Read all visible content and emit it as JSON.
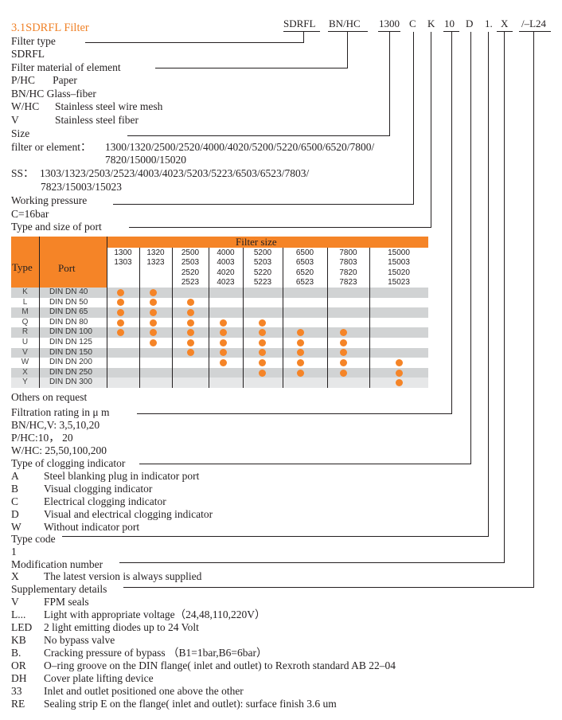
{
  "title": "3.1SDRFL Filter",
  "order_code": [
    {
      "key": "type",
      "text": "SDRFL"
    },
    {
      "key": "material",
      "text": "BN/HC"
    },
    {
      "key": "size",
      "text": "1300"
    },
    {
      "key": "pressure",
      "text": "C"
    },
    {
      "key": "port",
      "text": "K"
    },
    {
      "key": "rating",
      "text": "10"
    },
    {
      "key": "indicator",
      "text": "D"
    },
    {
      "key": "typecode",
      "text": "1."
    },
    {
      "key": "modification",
      "text": "X"
    },
    {
      "key": "supplementary",
      "text": "/–L24"
    }
  ],
  "sections": {
    "filter_type": {
      "heading": "Filter type",
      "value": "SDRFL"
    },
    "material": {
      "heading": "Filter material of element",
      "items": [
        {
          "code": "P/HC",
          "desc": "Paper"
        },
        {
          "code": "BN/HC",
          "desc": "Glass–fiber"
        },
        {
          "code": "W/HC",
          "desc": "Stainless steel wire mesh"
        },
        {
          "code": "V",
          "desc": "Stainless steel fiber"
        }
      ]
    },
    "size": {
      "heading": "Size",
      "filter_label": "filter or element：",
      "filter_line1": "1300/1320/2500/2520/4000/4020/5200/5220/6500/6520/7800/",
      "filter_line2": "7820/15000/15020",
      "ss_label": "SS：",
      "ss_line1": "1303/1323/2503/2523/4003/4023/5203/5223/6503/6523/7803/",
      "ss_line2": "7823/15003/15023"
    },
    "pressure": {
      "heading": "Working pressure",
      "value": "C=16bar"
    },
    "port": {
      "heading": "Type and size of port",
      "footer": "Others on request"
    },
    "rating": {
      "heading": "Filtration rating in μ m",
      "lines": [
        "BN/HC,V: 3,5,10,20",
        "P/HC:10， 20",
        "W/HC: 25,50,100,200"
      ]
    },
    "indicator": {
      "heading": "Type of clogging indicator",
      "items": [
        {
          "code": "A",
          "desc": "Steel blanking plug in indicator port"
        },
        {
          "code": "B",
          "desc": "Visual clogging indicator"
        },
        {
          "code": "C",
          "desc": "Electrical clogging indicator"
        },
        {
          "code": "D",
          "desc": "Visual and electrical clogging indicator"
        },
        {
          "code": "W",
          "desc": "Without indicator port"
        }
      ]
    },
    "typecode": {
      "heading": "Type code",
      "value": "1"
    },
    "modification": {
      "heading": "Modification number",
      "items": [
        {
          "code": "X",
          "desc": "The latest version is always supplied"
        }
      ]
    },
    "supplementary": {
      "heading": "Supplementary details",
      "items": [
        {
          "code": "V",
          "desc": "FPM seals"
        },
        {
          "code": "L...",
          "desc": "Light with appropriate voltage（24,48,110,220V）"
        },
        {
          "code": "LED",
          "desc": "2 light emitting diodes up to 24 Volt"
        },
        {
          "code": "KB",
          "desc": "No bypass valve"
        },
        {
          "code": "B.",
          "desc": "Cracking pressure of bypass （B1=1bar,B6=6bar）"
        },
        {
          "code": "OR",
          "desc": "O–ring groove on the DIN flange( inlet and outlet) to Rexroth standard AB 22–04"
        },
        {
          "code": "DH",
          "desc": "Cover plate lifting device"
        },
        {
          "code": "33",
          "desc": "Inlet and outlet positioned one above the other"
        },
        {
          "code": "RE",
          "desc": "Sealing strip E on the flange( inlet and outlet): surface finish 3.6 um"
        }
      ]
    }
  },
  "port_table": {
    "header_title": "Filter size",
    "type_label": "Type",
    "port_label": "Port",
    "size_columns": [
      [
        "1300",
        "1303"
      ],
      [
        "1320",
        "1323"
      ],
      [
        "2500",
        "2503",
        "2520",
        "2523"
      ],
      [
        "4000",
        "4003",
        "4020",
        "4023"
      ],
      [
        "5200",
        "5203",
        "5220",
        "5223"
      ],
      [
        "6500",
        "6503",
        "6520",
        "6523"
      ],
      [
        "7800",
        "7803",
        "7820",
        "7823"
      ],
      [
        "15000",
        "15003",
        "15020",
        "15023"
      ]
    ],
    "rows": [
      {
        "type": "K",
        "port": "DIN DN 40",
        "avail": [
          1,
          1,
          0,
          0,
          0,
          0,
          0,
          0
        ]
      },
      {
        "type": "L",
        "port": "DIN DN 50",
        "avail": [
          1,
          1,
          1,
          0,
          0,
          0,
          0,
          0
        ]
      },
      {
        "type": "M",
        "port": "DIN DN 65",
        "avail": [
          1,
          1,
          1,
          0,
          0,
          0,
          0,
          0
        ]
      },
      {
        "type": "Q",
        "port": "DIN DN 80",
        "avail": [
          1,
          1,
          1,
          1,
          1,
          0,
          0,
          0
        ]
      },
      {
        "type": "R",
        "port": "DIN DN 100",
        "avail": [
          1,
          1,
          1,
          1,
          1,
          1,
          1,
          0
        ]
      },
      {
        "type": "U",
        "port": "DIN DN 125",
        "avail": [
          0,
          1,
          1,
          1,
          1,
          1,
          1,
          0
        ]
      },
      {
        "type": "V",
        "port": "DIN DN 150",
        "avail": [
          0,
          0,
          1,
          1,
          1,
          1,
          1,
          0
        ]
      },
      {
        "type": "W",
        "port": "DIN DN 200",
        "avail": [
          0,
          0,
          0,
          1,
          1,
          1,
          1,
          1
        ]
      },
      {
        "type": "X",
        "port": "DIN DN 250",
        "avail": [
          0,
          0,
          0,
          0,
          1,
          1,
          1,
          1
        ]
      },
      {
        "type": "Y",
        "port": "DIN DN 300",
        "avail": [
          0,
          0,
          0,
          0,
          0,
          0,
          0,
          1
        ]
      }
    ],
    "colors": {
      "accent": "#f58427",
      "row_gray": "#d1d3d4",
      "row_light": "#e6e7e8",
      "row_white": "#ffffff"
    }
  }
}
